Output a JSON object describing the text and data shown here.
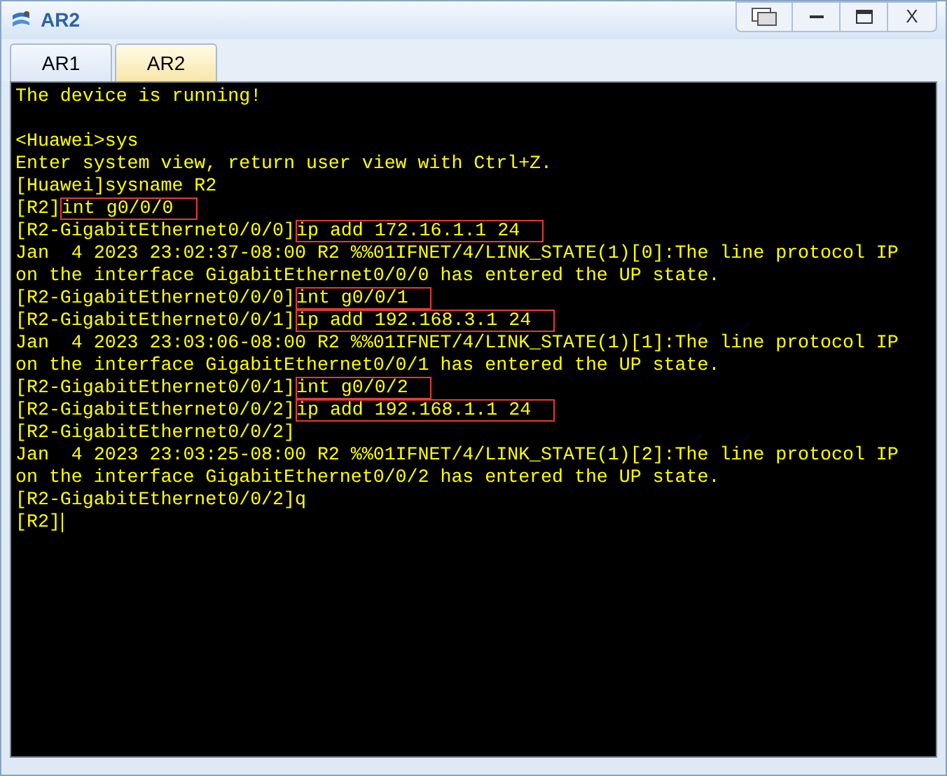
{
  "window": {
    "title": "AR2",
    "close_label": "X"
  },
  "tabs": [
    {
      "label": "AR1",
      "selected": false
    },
    {
      "label": "AR2",
      "selected": true
    }
  ],
  "terminal": {
    "blocks": [
      {
        "lines": [
          {
            "text": "The device is running!"
          }
        ]
      },
      {
        "lines": [
          {
            "text": "<Huawei>sys"
          },
          {
            "text": "Enter system view, return user view with Ctrl+Z."
          },
          {
            "text": "[Huawei]sysname R2"
          },
          {
            "text": "[R2]",
            "command": "int g0/0/0",
            "highlighted": true
          },
          {
            "text": "[R2-GigabitEthernet0/0/0]",
            "command": "ip add 172.16.1.1 24",
            "highlighted": true
          },
          {
            "text": "Jan  4 2023 23:02:37-08:00 R2 %%01IFNET/4/LINK_STATE(1)[0]:The line protocol IP"
          },
          {
            "text": "on the interface GigabitEthernet0/0/0 has entered the UP state."
          },
          {
            "text": "[R2-GigabitEthernet0/0/0]",
            "command": "int g0/0/1",
            "highlighted": true
          },
          {
            "text": "[R2-GigabitEthernet0/0/1]",
            "command": "ip add 192.168.3.1 24",
            "highlighted": true
          },
          {
            "text": "Jan  4 2023 23:03:06-08:00 R2 %%01IFNET/4/LINK_STATE(1)[1]:The line protocol IP"
          },
          {
            "text": "on the interface GigabitEthernet0/0/1 has entered the UP state."
          },
          {
            "text": "[R2-GigabitEthernet0/0/1]",
            "command": "int g0/0/2",
            "highlighted": true
          },
          {
            "text": "[R2-GigabitEthernet0/0/2]",
            "command": "ip add 192.168.1.1 24",
            "highlighted": true
          },
          {
            "text": "[R2-GigabitEthernet0/0/2]"
          },
          {
            "text": "Jan  4 2023 23:03:25-08:00 R2 %%01IFNET/4/LINK_STATE(1)[2]:The line protocol IP"
          },
          {
            "text": "on the interface GigabitEthernet0/0/2 has entered the UP state."
          },
          {
            "text": "[R2-GigabitEthernet0/0/2]q"
          },
          {
            "text": "[R2]",
            "cursor": true
          }
        ]
      }
    ]
  }
}
